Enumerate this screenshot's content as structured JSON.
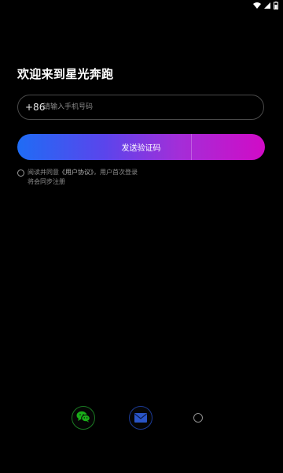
{
  "status_bar": {
    "icons": [
      "wifi-icon",
      "signal-icon",
      "battery-icon"
    ]
  },
  "login": {
    "title": "欢迎来到星光奔跑",
    "country_code": "+86",
    "phone_placeholder": "请输入手机号码",
    "send_code_label": "发送验证码"
  },
  "agreement": {
    "prefix": "阅读并同意",
    "link_label": "《用户协议》",
    "suffix": "，用户首次登录",
    "line2": "将会同步注册"
  },
  "social_login": {
    "icons": [
      "wechat-icon",
      "mail-icon",
      "more-icon"
    ]
  },
  "colors": {
    "background": "#000000",
    "gradient_start": "#1f6cf5",
    "gradient_end": "#d10bc6",
    "wechat_green": "#1aad19",
    "mail_blue": "#2a55c8"
  }
}
